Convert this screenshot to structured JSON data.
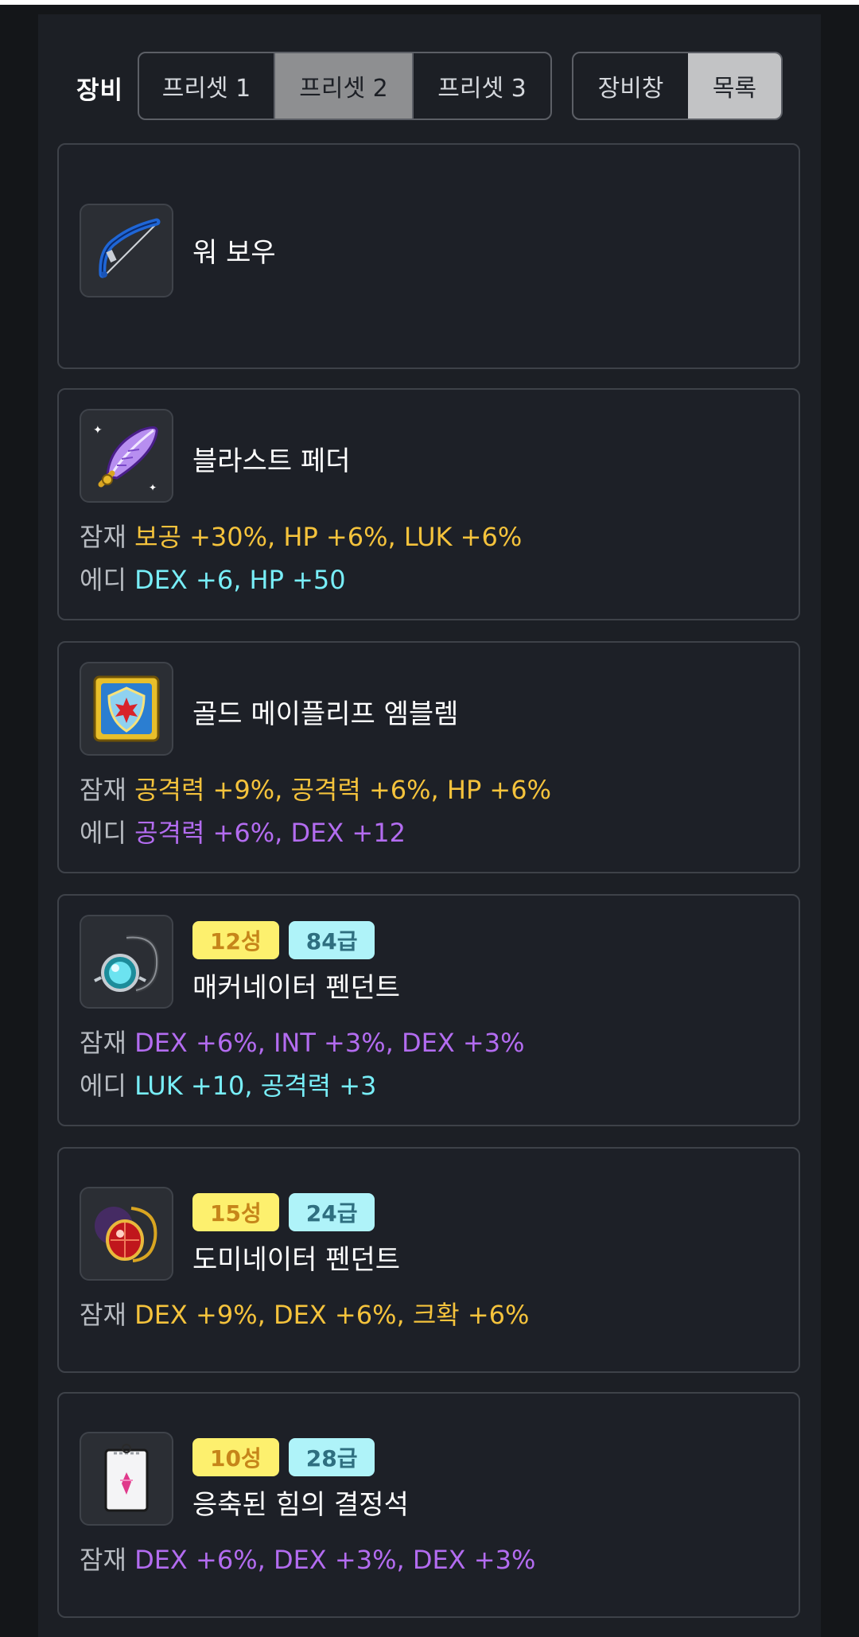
{
  "header": {
    "title": "장비",
    "presets": [
      "프리셋 1",
      "프리셋 2",
      "프리셋 3"
    ],
    "active_preset": "프리셋 2",
    "views": [
      "장비창",
      "목록"
    ],
    "active_view": "목록"
  },
  "labels": {
    "potential": "잠재",
    "additional": "에디"
  },
  "items": [
    {
      "name": "워 보우",
      "icon": "war-bow-icon"
    },
    {
      "name": "블라스트 페더",
      "icon": "blast-feather-icon",
      "potential": "보공 +30%, HP +6%, LUK +6%",
      "additional": "DEX +6, HP +50"
    },
    {
      "name": "골드 메이플리프 엠블렘",
      "icon": "gold-mapleleaf-emblem-icon",
      "potential": "공격력 +9%, 공격력 +6%, HP +6%",
      "additional": "공격력 +6%, DEX +12"
    },
    {
      "name": "매커네이터 펜던트",
      "icon": "mechanator-pendant-icon",
      "star": "12성",
      "grade": "84급",
      "potential": "DEX +6%, INT +3%, DEX +3%",
      "additional": "LUK +10, 공격력 +3"
    },
    {
      "name": "도미네이터 펜던트",
      "icon": "dominator-pendant-icon",
      "star": "15성",
      "grade": "24급",
      "potential": "DEX +9%, DEX +6%, 크확 +6%"
    },
    {
      "name": "응축된 힘의 결정석",
      "icon": "condensed-power-crystal-icon",
      "star": "10성",
      "grade": "28급",
      "potential": "DEX +6%, DEX +3%, DEX +3%"
    }
  ],
  "colors": {
    "legendary": "#f5c33c",
    "unique": "#b36cf0",
    "rare": "#78eef8",
    "star_badge_bg": "#fdf06e",
    "grade_badge_bg": "#aff3f9"
  }
}
